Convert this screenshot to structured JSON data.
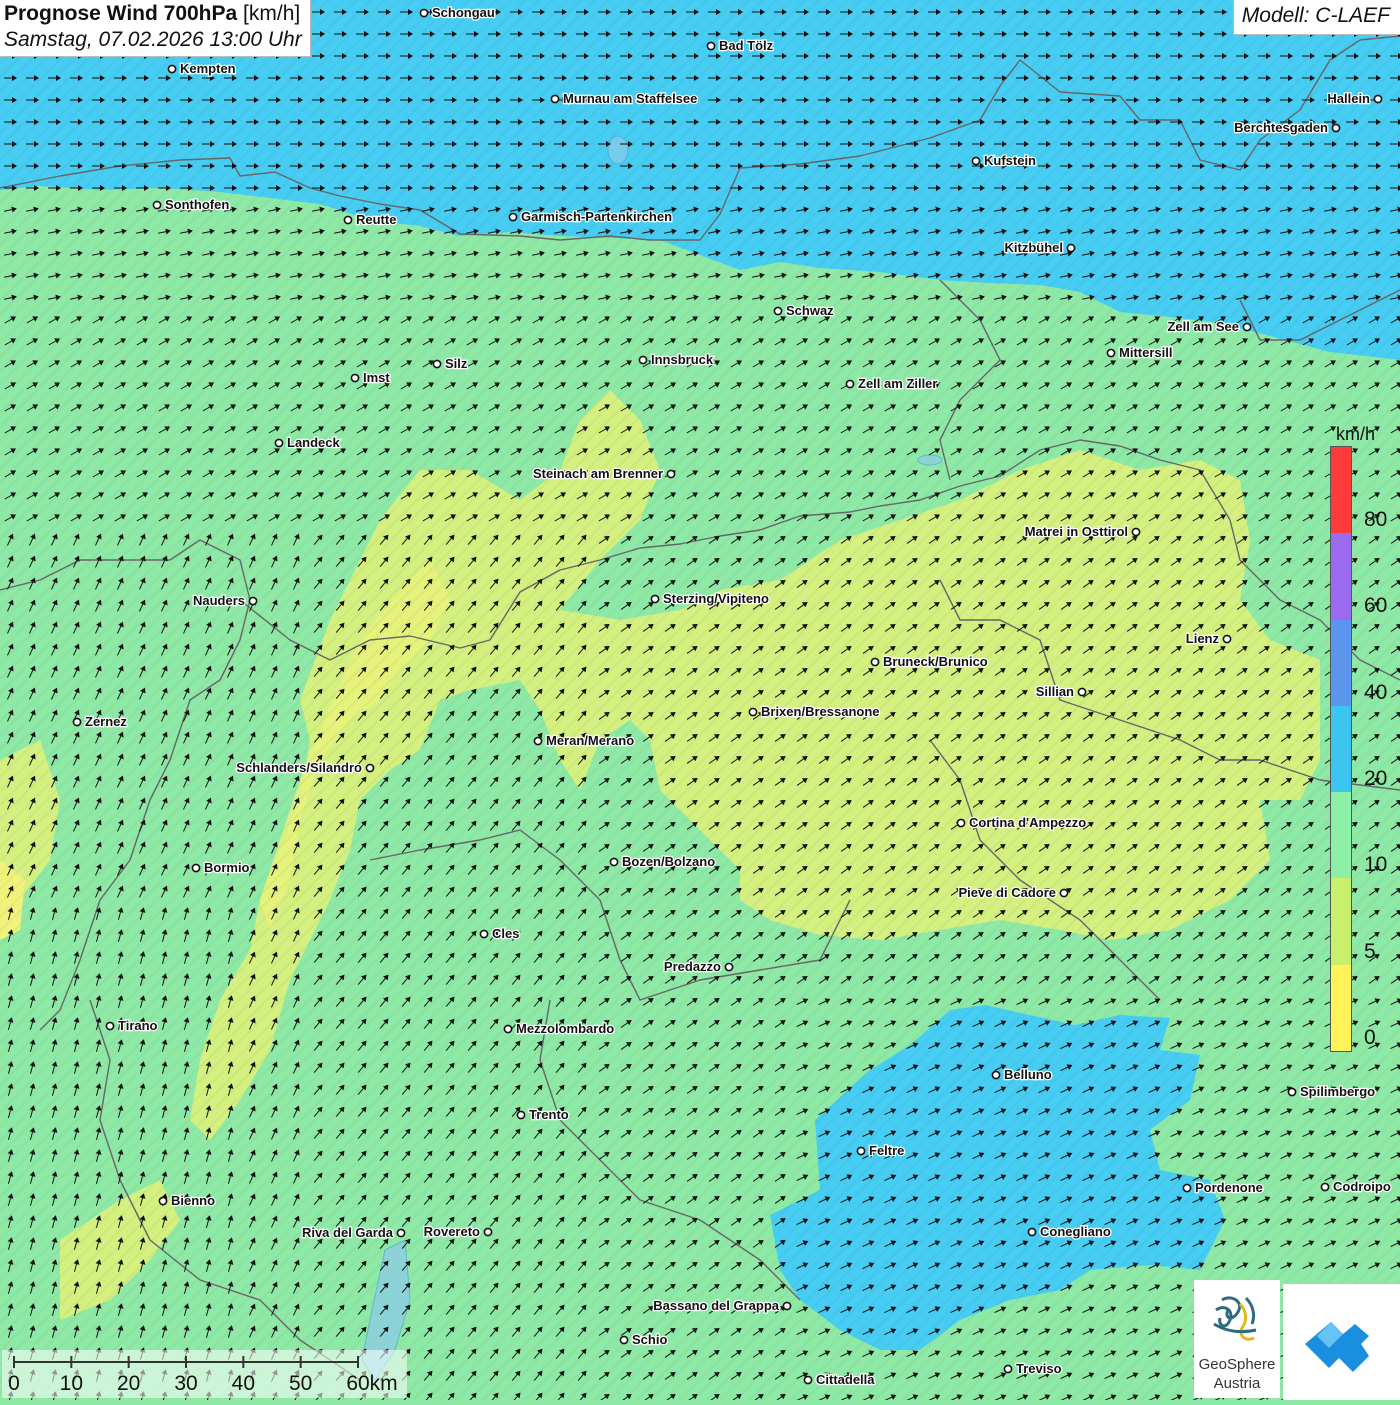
{
  "title": {
    "main": "Prognose Wind 700hPa",
    "unit": "[km/h]",
    "datetime": "Samstag, 07.02.2026 13:00 Uhr"
  },
  "model": "Modell: C-LAEF",
  "legend": {
    "unit": "km/h",
    "ticks": [
      "80",
      "60",
      "40",
      "20",
      "10",
      "5",
      "0"
    ],
    "colors": [
      "#ff3a3a",
      "#9b6bef",
      "#5b96ee",
      "#3cc6ef",
      "#8ef0a6",
      "#c8f06a",
      "#fff35a"
    ]
  },
  "scalebar": {
    "labels": [
      "0",
      "10",
      "20",
      "30",
      "40",
      "50",
      "60km"
    ]
  },
  "logos": {
    "geosphere_name": "GeoSphere",
    "geosphere_sub": "Austria"
  },
  "colors": {
    "zone_blue": "#47cdf3",
    "zone_green": "#8fe9a6",
    "zone_yellow": "#d3f080",
    "zone_yellow_strong": "#e7f27a",
    "border": "#666666",
    "arrow": "#111111"
  },
  "cities": [
    {
      "name": "Schongau"
    },
    {
      "name": "Bad Tölz"
    },
    {
      "name": "Kempten"
    },
    {
      "name": "Murnau am Staffelsee"
    },
    {
      "name": "Hallein"
    },
    {
      "name": "Berchtesgaden"
    },
    {
      "name": "Kufstein"
    },
    {
      "name": "Sonthofen"
    },
    {
      "name": "Reutte"
    },
    {
      "name": "Garmisch-Partenkirchen"
    },
    {
      "name": "Kitzbühel"
    },
    {
      "name": "Schwaz"
    },
    {
      "name": "Zell am See"
    },
    {
      "name": "Mittersill"
    },
    {
      "name": "Innsbruck"
    },
    {
      "name": "Silz"
    },
    {
      "name": "Imst"
    },
    {
      "name": "Zell am Ziller"
    },
    {
      "name": "Landeck"
    },
    {
      "name": "Steinach am Brenner"
    },
    {
      "name": "Matrei in Osttirol"
    },
    {
      "name": "Nauders"
    },
    {
      "name": "Sterzing/Vipiteno"
    },
    {
      "name": "Lienz"
    },
    {
      "name": "Bruneck/Brunico"
    },
    {
      "name": "Sillian"
    },
    {
      "name": "Brixen/Bressanone"
    },
    {
      "name": "Zernez"
    },
    {
      "name": "Meran/Merano"
    },
    {
      "name": "Schlanders/Silandro"
    },
    {
      "name": "Cortina d'Ampezzo"
    },
    {
      "name": "Bozen/Bolzano"
    },
    {
      "name": "Bormio"
    },
    {
      "name": "Pieve di Cadore"
    },
    {
      "name": "Cles"
    },
    {
      "name": "Predazzo"
    },
    {
      "name": "Tirano"
    },
    {
      "name": "Mezzolombardo"
    },
    {
      "name": "Belluno"
    },
    {
      "name": "Spilimbergo"
    },
    {
      "name": "Trento"
    },
    {
      "name": "Feltre"
    },
    {
      "name": "Pordenone"
    },
    {
      "name": "Codroipo"
    },
    {
      "name": "Bienno"
    },
    {
      "name": "Riva del Garda"
    },
    {
      "name": "Rovereto"
    },
    {
      "name": "Conegliano"
    },
    {
      "name": "Bassano del Grappa"
    },
    {
      "name": "Schio"
    },
    {
      "name": "Treviso"
    },
    {
      "name": "Cittadella"
    }
  ]
}
